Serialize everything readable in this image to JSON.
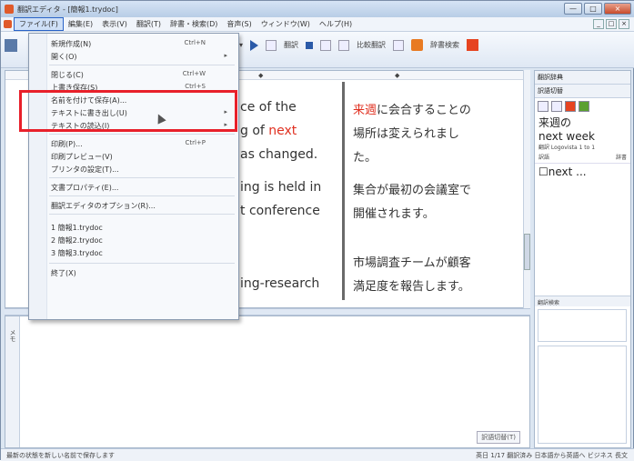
{
  "window": {
    "title": "翻訳エディタ - [簡報1.trydoc]",
    "controls": [
      "—",
      "□",
      "×"
    ]
  },
  "menubar": {
    "items": [
      {
        "label": "ファイル(F)",
        "active": true
      },
      {
        "label": "編集(E)"
      },
      {
        "label": "表示(V)"
      },
      {
        "label": "翻訳(T)"
      },
      {
        "label": "辞書・検索(D)"
      },
      {
        "label": "音声(S)"
      },
      {
        "label": "ウィンドウ(W)"
      },
      {
        "label": "ヘルプ(H)"
      }
    ],
    "mdi_controls": [
      "_",
      "□",
      "×"
    ]
  },
  "toolbar": {
    "translate_label": "翻訳",
    "compare_label": "比較翻訳",
    "dict_label": "辞書検索"
  },
  "file_menu": {
    "items": [
      {
        "label": "新規作成(N)",
        "shortcut": "Ctrl+N"
      },
      {
        "label": "開く(O)",
        "arrow": "▸"
      },
      {
        "label": "閉じる(C)",
        "shortcut": "Ctrl+W"
      },
      {
        "label": "上書き保存(S)",
        "shortcut": "Ctrl+S"
      },
      {
        "label": "名前を付けて保存(A)..."
      },
      {
        "label": "テキストに書き出し(U)",
        "arrow": "▸"
      },
      {
        "label": "テキストの読込(I)",
        "arrow": "▸"
      },
      {
        "label": "印刷(P)...",
        "shortcut": "Ctrl+P"
      },
      {
        "label": "印刷プレビュー(V)"
      },
      {
        "label": "プリンタの設定(T)..."
      },
      {
        "label": "文書プロパティ(E)..."
      },
      {
        "label": "翻訳エディタのオプション(R)..."
      },
      {
        "label": "1 簡報1.trydoc"
      },
      {
        "label": "2 簡報2.trydoc"
      },
      {
        "label": "3 簡報3.trydoc"
      },
      {
        "label": "終了(X)"
      }
    ]
  },
  "document": {
    "source_lines": [
      {
        "text": "ce of the",
        "red": ""
      },
      {
        "text": "g of ",
        "red": "next"
      },
      {
        "text": "as changed.",
        "red": ""
      },
      {
        "text": "ing is held in",
        "red": ""
      },
      {
        "text": "t conference",
        "red": ""
      },
      {
        "text": "ing-research",
        "red": ""
      }
    ],
    "target_lines": [
      {
        "red": "来週",
        "text": "に会合することの"
      },
      {
        "red": "",
        "text": "場所は変えられまし"
      },
      {
        "red": "",
        "text": "た。"
      },
      {
        "red": "",
        "text": "集合が最初の会議室で"
      },
      {
        "red": "",
        "text": "開催されます。"
      },
      {
        "red": "",
        "text": "市場調査チームが顧客"
      },
      {
        "red": "",
        "text": "満足度を報告します。"
      }
    ]
  },
  "dict_panel": {
    "header": "翻訳辞典",
    "sub_header": "訳語切替",
    "word_jp": "来週の",
    "word_en": "next week",
    "source": "翻訳 Logovista 1 to 1",
    "col1": "訳語",
    "col2": "辞書",
    "entry": "next ...",
    "lower_header": "翻訳検索"
  },
  "bottom_pane": {
    "side_label": "メモ",
    "button": "訳語切替(T)"
  },
  "statusbar": {
    "left": "最新の状態を新しい名前で保存します",
    "right": "英日 1/17 翻訳済み 日本語から英語へ ビジネス 長文"
  }
}
